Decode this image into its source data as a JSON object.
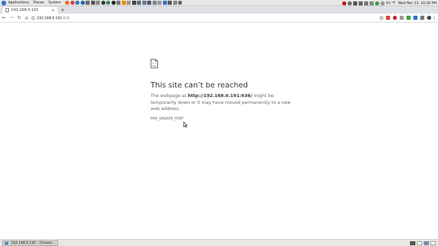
{
  "top_panel": {
    "menus": [
      "Applications",
      "Places",
      "System"
    ],
    "temperature": "61 °F",
    "clock": "Wed Mar 13, 10:26 PM"
  },
  "browser": {
    "tab_title": "192.168.0.191",
    "new_tab_label": "+",
    "url_host": "192.168.0.191",
    "url_port": ":636"
  },
  "error_page": {
    "title": "This site can’t be reached",
    "desc_prefix": "The webpage at ",
    "desc_url": "http://192.168.0.191:636/",
    "desc_suffix": " might be temporarily down or it may have moved permanently to a new web address.",
    "code": "ERR_UNSAFE_PORT"
  },
  "taskbar": {
    "window_label": "192.168.0.191 - Chromi..."
  }
}
